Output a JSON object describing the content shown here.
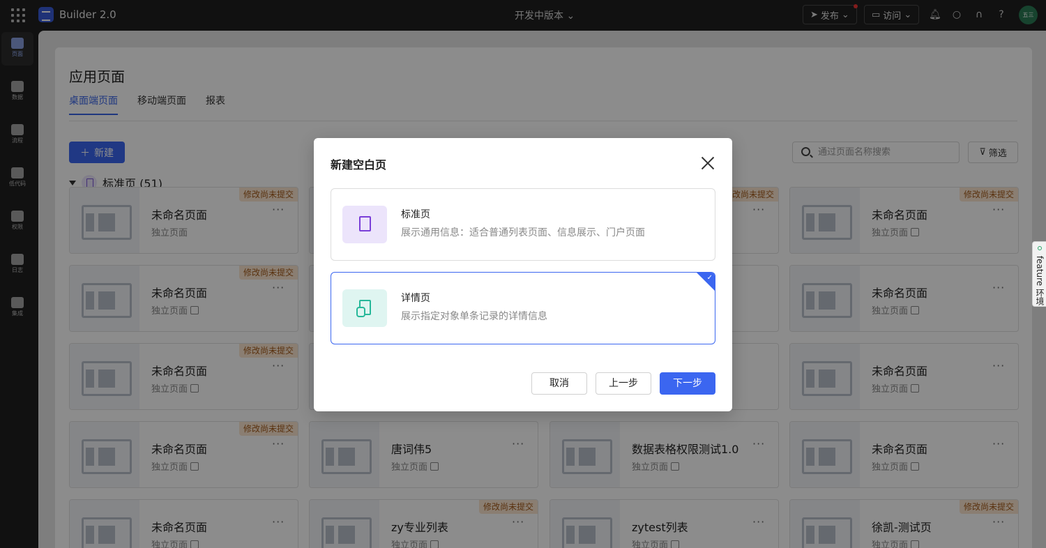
{
  "topbar": {
    "app_title": "Builder 2.0",
    "version": "开发中版本",
    "publish_label": "发布",
    "visit_label": "访问",
    "avatar_text": "五三"
  },
  "sidebar": {
    "items": [
      {
        "label": "页面",
        "icon": "page-icon"
      },
      {
        "label": "数据",
        "icon": "database-icon"
      },
      {
        "label": "流程",
        "icon": "flow-icon"
      },
      {
        "label": "低代码",
        "icon": "code-icon"
      },
      {
        "label": "权限",
        "icon": "users-icon"
      },
      {
        "label": "日志",
        "icon": "log-icon"
      },
      {
        "label": "集成",
        "icon": "key-icon"
      }
    ]
  },
  "main": {
    "title": "应用页面",
    "tabs": [
      {
        "label": "桌面端页面"
      },
      {
        "label": "移动端页面"
      },
      {
        "label": "报表"
      }
    ],
    "new_label": "新建",
    "search_placeholder": "通过页面名称搜索",
    "filter_label": "筛选",
    "group_label": "标准页 (51)",
    "badge_label": "修改尚未提交",
    "cards": [
      {
        "name": "未命名页面",
        "sub": "独立页面"
      },
      {
        "name": "未命名页面",
        "sub": "独立页面"
      },
      {
        "name": "未命名页面",
        "sub": "独立页面"
      },
      {
        "name": "未命名页面",
        "sub": "独立页面"
      },
      {
        "name": "未命名页面",
        "sub": "独立页面"
      },
      {
        "name": "未命名页面",
        "sub": "独立页面"
      },
      {
        "name": "未命名页面",
        "sub": "独立页面"
      },
      {
        "name": "唐词伟5",
        "sub": "独立页面"
      },
      {
        "name": "数据表格权限测试1.0",
        "sub": "独立页面"
      },
      {
        "name": "未命名页面",
        "sub": "独立页面"
      },
      {
        "name": "未命名页面",
        "sub": "独立页面"
      },
      {
        "name": "zy专业列表",
        "sub": "独立页面"
      },
      {
        "name": "zytest列表",
        "sub": "独立页面"
      },
      {
        "name": "徐凯-测试页",
        "sub": "独立页面"
      }
    ]
  },
  "modal": {
    "title": "新建空白页",
    "options": [
      {
        "title": "标准页",
        "desc": "展示通用信息：适合普通列表页面、信息展示、门户页面"
      },
      {
        "title": "详情页",
        "desc": "展示指定对象单条记录的详情信息"
      }
    ],
    "cancel_label": "取消",
    "prev_label": "上一步",
    "next_label": "下一步"
  },
  "feature_tab": {
    "label": "feature 环境"
  },
  "colors": {
    "primary": "#3b66f0",
    "badge_bg": "#fbe6cf",
    "badge_text": "#a45b1c"
  }
}
